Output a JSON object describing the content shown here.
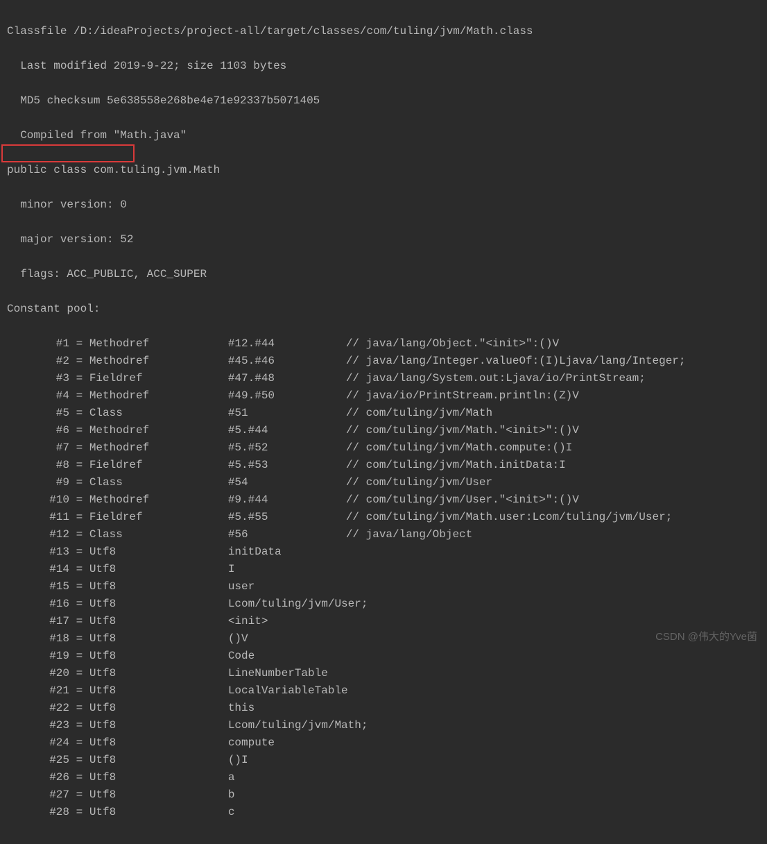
{
  "header": {
    "line1": "Classfile /D:/ideaProjects/project-all/target/classes/com/tuling/jvm/Math.class",
    "line2": "  Last modified 2019-9-22; size 1103 bytes",
    "line3": "  MD5 checksum 5e638558e268be4e71e92337b5071405",
    "line4": "  Compiled from \"Math.java\"",
    "line5": "public class com.tuling.jvm.Math",
    "line6": "  minor version: 0",
    "line7": "  major version: 52",
    "line8": "  flags: ACC_PUBLIC, ACC_SUPER",
    "line9": "Constant pool:"
  },
  "pool": [
    {
      "idx": "#1",
      "kind": "Methodref",
      "ref": "#12.#44",
      "cmt": "// java/lang/Object.\"<init>\":()V"
    },
    {
      "idx": "#2",
      "kind": "Methodref",
      "ref": "#45.#46",
      "cmt": "// java/lang/Integer.valueOf:(I)Ljava/lang/Integer;"
    },
    {
      "idx": "#3",
      "kind": "Fieldref",
      "ref": "#47.#48",
      "cmt": "// java/lang/System.out:Ljava/io/PrintStream;"
    },
    {
      "idx": "#4",
      "kind": "Methodref",
      "ref": "#49.#50",
      "cmt": "// java/io/PrintStream.println:(Z)V"
    },
    {
      "idx": "#5",
      "kind": "Class",
      "ref": "#51",
      "cmt": "// com/tuling/jvm/Math"
    },
    {
      "idx": "#6",
      "kind": "Methodref",
      "ref": "#5.#44",
      "cmt": "// com/tuling/jvm/Math.\"<init>\":()V"
    },
    {
      "idx": "#7",
      "kind": "Methodref",
      "ref": "#5.#52",
      "cmt": "// com/tuling/jvm/Math.compute:()I"
    },
    {
      "idx": "#8",
      "kind": "Fieldref",
      "ref": "#5.#53",
      "cmt": "// com/tuling/jvm/Math.initData:I"
    },
    {
      "idx": "#9",
      "kind": "Class",
      "ref": "#54",
      "cmt": "// com/tuling/jvm/User"
    },
    {
      "idx": "#10",
      "kind": "Methodref",
      "ref": "#9.#44",
      "cmt": "// com/tuling/jvm/User.\"<init>\":()V"
    },
    {
      "idx": "#11",
      "kind": "Fieldref",
      "ref": "#5.#55",
      "cmt": "// com/tuling/jvm/Math.user:Lcom/tuling/jvm/User;"
    },
    {
      "idx": "#12",
      "kind": "Class",
      "ref": "#56",
      "cmt": "// java/lang/Object"
    },
    {
      "idx": "#13",
      "kind": "Utf8",
      "ref": "initData",
      "cmt": ""
    },
    {
      "idx": "#14",
      "kind": "Utf8",
      "ref": "I",
      "cmt": ""
    },
    {
      "idx": "#15",
      "kind": "Utf8",
      "ref": "user",
      "cmt": ""
    },
    {
      "idx": "#16",
      "kind": "Utf8",
      "ref": "Lcom/tuling/jvm/User;",
      "cmt": ""
    },
    {
      "idx": "#17",
      "kind": "Utf8",
      "ref": "<init>",
      "cmt": ""
    },
    {
      "idx": "#18",
      "kind": "Utf8",
      "ref": "()V",
      "cmt": ""
    },
    {
      "idx": "#19",
      "kind": "Utf8",
      "ref": "Code",
      "cmt": ""
    },
    {
      "idx": "#20",
      "kind": "Utf8",
      "ref": "LineNumberTable",
      "cmt": ""
    },
    {
      "idx": "#21",
      "kind": "Utf8",
      "ref": "LocalVariableTable",
      "cmt": ""
    },
    {
      "idx": "#22",
      "kind": "Utf8",
      "ref": "this",
      "cmt": ""
    },
    {
      "idx": "#23",
      "kind": "Utf8",
      "ref": "Lcom/tuling/jvm/Math;",
      "cmt": ""
    },
    {
      "idx": "#24",
      "kind": "Utf8",
      "ref": "compute",
      "cmt": ""
    },
    {
      "idx": "#25",
      "kind": "Utf8",
      "ref": "()I",
      "cmt": ""
    },
    {
      "idx": "#26",
      "kind": "Utf8",
      "ref": "a",
      "cmt": ""
    },
    {
      "idx": "#27",
      "kind": "Utf8",
      "ref": "b",
      "cmt": ""
    },
    {
      "idx": "#28",
      "kind": "Utf8",
      "ref": "c",
      "cmt": ""
    }
  ],
  "watermark": "CSDN @伟大的Yve菌"
}
